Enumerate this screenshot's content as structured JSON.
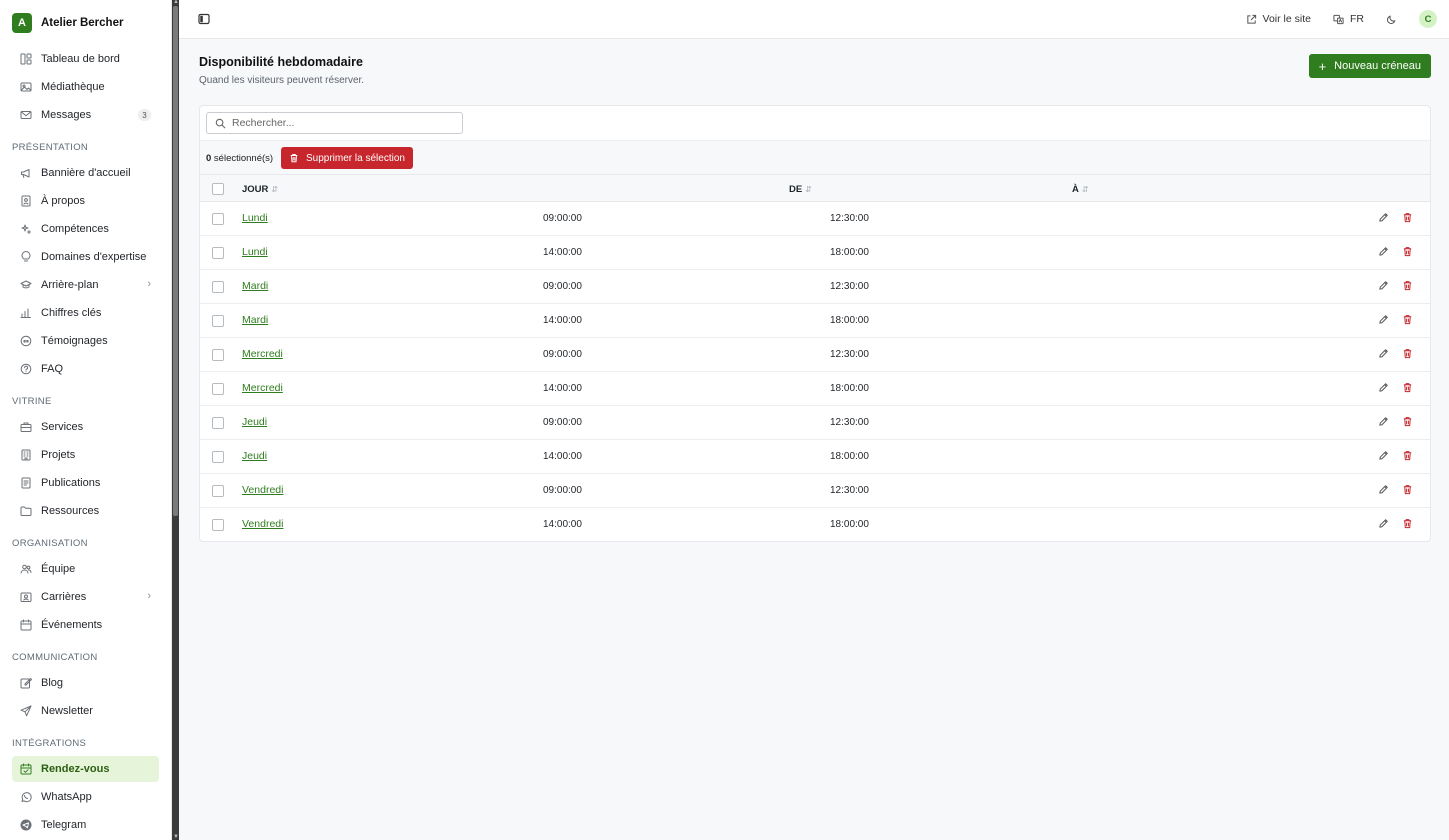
{
  "app": {
    "logo_letter": "A",
    "name": "Atelier Bercher"
  },
  "sidebar": {
    "top_items": [
      {
        "label": "Tableau de bord",
        "icon": "dashboard-icon"
      },
      {
        "label": "Médiathèque",
        "icon": "image-icon"
      },
      {
        "label": "Messages",
        "icon": "mail-icon",
        "badge": "3"
      }
    ],
    "sections": [
      {
        "title": "PRÉSENTATION",
        "items": [
          {
            "label": "Bannière d'accueil",
            "icon": "megaphone-icon"
          },
          {
            "label": "À propos",
            "icon": "id-card-icon"
          },
          {
            "label": "Compétences",
            "icon": "sparkles-icon"
          },
          {
            "label": "Domaines d'expertise",
            "icon": "lightbulb-icon"
          },
          {
            "label": "Arrière-plan",
            "icon": "graduation-cap-icon",
            "chevron": true
          },
          {
            "label": "Chiffres clés",
            "icon": "bar-chart-icon"
          },
          {
            "label": "Témoignages",
            "icon": "quote-icon"
          },
          {
            "label": "FAQ",
            "icon": "help-circle-icon"
          }
        ]
      },
      {
        "title": "VITRINE",
        "items": [
          {
            "label": "Services",
            "icon": "briefcase-icon"
          },
          {
            "label": "Projets",
            "icon": "building-icon"
          },
          {
            "label": "Publications",
            "icon": "file-text-icon"
          },
          {
            "label": "Ressources",
            "icon": "folder-icon"
          }
        ]
      },
      {
        "title": "ORGANISATION",
        "items": [
          {
            "label": "Équipe",
            "icon": "users-icon"
          },
          {
            "label": "Carrières",
            "icon": "contact-icon",
            "chevron": true
          },
          {
            "label": "Événements",
            "icon": "calendar-icon"
          }
        ]
      },
      {
        "title": "COMMUNICATION",
        "items": [
          {
            "label": "Blog",
            "icon": "edit-icon"
          },
          {
            "label": "Newsletter",
            "icon": "send-icon"
          }
        ]
      },
      {
        "title": "INTÉGRATIONS",
        "items": [
          {
            "label": "Rendez-vous",
            "icon": "calendar-check-icon",
            "active": true
          },
          {
            "label": "WhatsApp",
            "icon": "whatsapp-icon"
          },
          {
            "label": "Telegram",
            "icon": "telegram-icon"
          }
        ]
      }
    ]
  },
  "topbar": {
    "view_site": "Voir le site",
    "language": "FR",
    "avatar_letter": "C"
  },
  "page": {
    "title": "Disponibilité hebdomadaire",
    "subtitle": "Quand les visiteurs peuvent réserver.",
    "new_button": "Nouveau créneau",
    "search_placeholder": "Rechercher...",
    "selected_count": "0",
    "selected_suffix": " sélectionné(s)",
    "delete_selection": "Supprimer la sélection"
  },
  "table": {
    "columns": [
      "JOUR",
      "DE",
      "À"
    ],
    "rows": [
      {
        "day": "Lundi",
        "from": "09:00:00",
        "to": "12:30:00"
      },
      {
        "day": "Lundi",
        "from": "14:00:00",
        "to": "18:00:00"
      },
      {
        "day": "Mardi",
        "from": "09:00:00",
        "to": "12:30:00"
      },
      {
        "day": "Mardi",
        "from": "14:00:00",
        "to": "18:00:00"
      },
      {
        "day": "Mercredi",
        "from": "09:00:00",
        "to": "12:30:00"
      },
      {
        "day": "Mercredi",
        "from": "14:00:00",
        "to": "18:00:00"
      },
      {
        "day": "Jeudi",
        "from": "09:00:00",
        "to": "12:30:00"
      },
      {
        "day": "Jeudi",
        "from": "14:00:00",
        "to": "18:00:00"
      },
      {
        "day": "Vendredi",
        "from": "09:00:00",
        "to": "12:30:00"
      },
      {
        "day": "Vendredi",
        "from": "14:00:00",
        "to": "18:00:00"
      }
    ]
  },
  "colors": {
    "accent": "#2f7d1f",
    "danger": "#c8262d",
    "active_bg": "#e6f5da"
  }
}
